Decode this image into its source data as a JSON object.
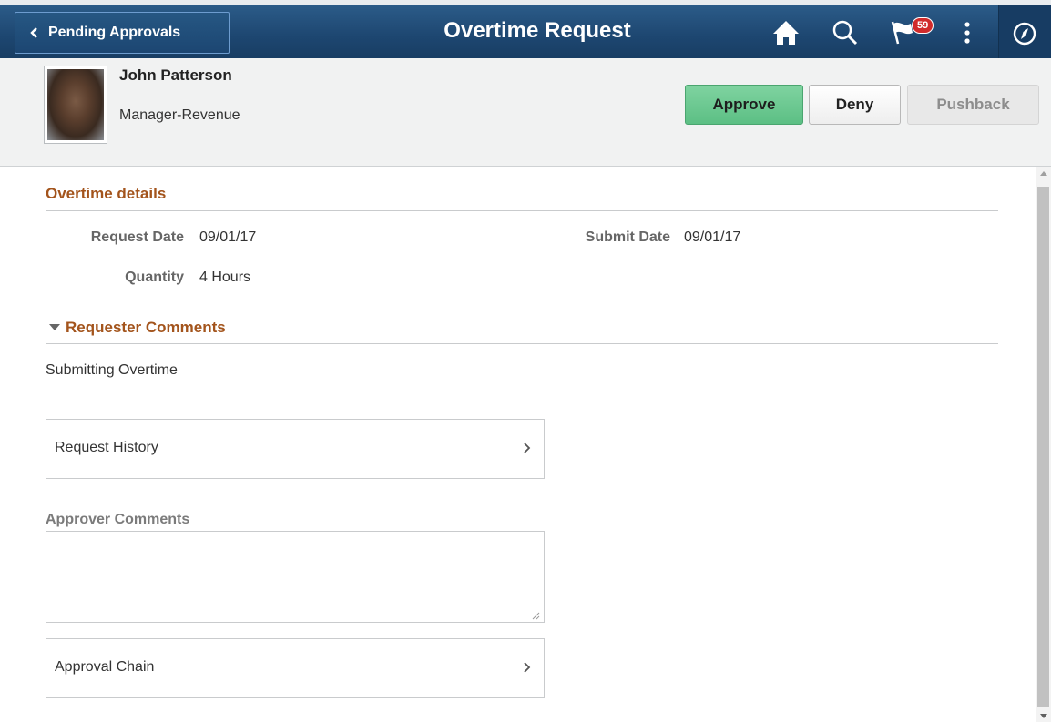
{
  "header": {
    "back_label": "Pending Approvals",
    "title": "Overtime Request",
    "notification_count": "59",
    "icons": [
      "home-icon",
      "search-icon",
      "flag-icon",
      "actions-menu-icon",
      "navbar-compass-icon"
    ]
  },
  "employee": {
    "name": "John Patterson",
    "job_title": "Manager-Revenue"
  },
  "actions": {
    "approve_label": "Approve",
    "deny_label": "Deny",
    "pushback_label": "Pushback"
  },
  "overtime_details": {
    "section_title": "Overtime details",
    "request_date_label": "Request Date",
    "request_date_value": "09/01/17",
    "submit_date_label": "Submit Date",
    "submit_date_value": "09/01/17",
    "quantity_label": "Quantity",
    "quantity_value": "4 Hours"
  },
  "requester_comments": {
    "section_title": "Requester Comments",
    "text": "Submitting Overtime"
  },
  "request_history": {
    "label": "Request History"
  },
  "approver_comments": {
    "label": "Approver Comments",
    "value": ""
  },
  "approval_chain": {
    "label": "Approval Chain"
  },
  "colors": {
    "header_bg": "#1d4670",
    "section_title": "#a3541c",
    "approve_bg": "#5cbf84",
    "badge_bg": "#d12b2b"
  }
}
